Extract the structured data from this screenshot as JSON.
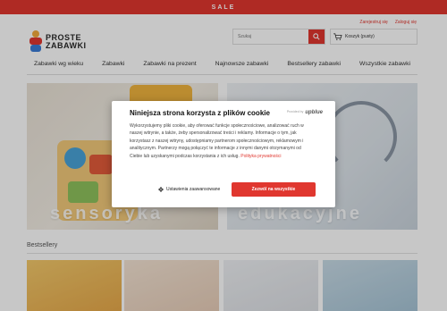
{
  "sale_bar": {
    "text": "SALE"
  },
  "top_links": {
    "register": "Zarejestruj się",
    "login": "Zaloguj się"
  },
  "logo": {
    "line1": "PROSTE",
    "line2": "ZABAWKI"
  },
  "search": {
    "placeholder": "Szukaj"
  },
  "cart": {
    "label": "Koszyk (pusty)"
  },
  "nav": {
    "items": [
      "Zabawki wg wieku",
      "Zabawki",
      "Zabawki na prezent",
      "Najnowsze zabawki",
      "Bestsellery zabawki",
      "Wszystkie zabawki"
    ]
  },
  "hero": {
    "left_word": "sensoryka",
    "right_word": "edukacyjne"
  },
  "section": {
    "title": "Bestsellery"
  },
  "cookie": {
    "title": "Niniejsza strona korzysta z plików cookie",
    "provided_by": "Provided by",
    "provider": "upblue",
    "body": "Wykorzystujemy pliki cookie, aby oferować funkcje społecznościowe, analizować ruch w naszej witrynie, a także, żeby spersonalizować treści i reklamy. Informacje o tym, jak korzystasz z naszej witryny, udostępniamy partnerom społecznościowym, reklamowym i analitycznym. Partnerzy mogą połączyć te informacje z innymi danymi otrzymanymi od Ciebie lub uzyskanymi podczas korzystania z ich usług.",
    "policy_link": "Polityka prywatności",
    "settings_label": "Ustawienia zaawansowane",
    "accept_label": "Zezwól na wszystkie"
  },
  "colors": {
    "accent": "#e0372f"
  }
}
